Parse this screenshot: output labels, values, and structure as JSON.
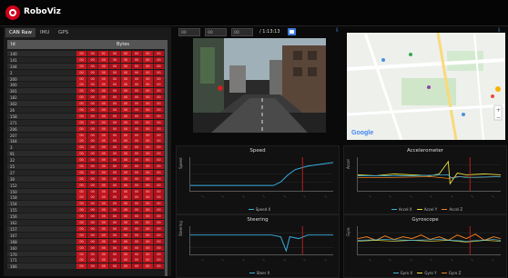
{
  "app": {
    "title": "RoboViz"
  },
  "left": {
    "tabs": [
      "CAN Raw",
      "IMU",
      "GPS"
    ],
    "columns": {
      "id": "Id",
      "bytes": "Bytes"
    },
    "rows": [
      {
        "id": "140",
        "bytes": [
          "00",
          "00",
          "01",
          "00",
          "00",
          "00",
          "00",
          "00"
        ]
      },
      {
        "id": "141",
        "bytes": [
          "00",
          "00",
          "00",
          "30",
          "30",
          "00",
          "00",
          "00"
        ]
      },
      {
        "id": "144",
        "bytes": [
          "00",
          "00",
          "00",
          "00",
          "00",
          "00",
          "00",
          "00"
        ]
      },
      {
        "id": "2",
        "bytes": [
          "00",
          "00",
          "00",
          "00",
          "00",
          "00",
          "00",
          "00"
        ]
      },
      {
        "id": "200",
        "bytes": [
          "00",
          "00",
          "00",
          "00",
          "00",
          "00",
          "00",
          "00"
        ]
      },
      {
        "id": "300",
        "bytes": [
          "00",
          "00",
          "00",
          "00",
          "00",
          "00",
          "00",
          "00"
        ]
      },
      {
        "id": "301",
        "bytes": [
          "00",
          "00",
          "00",
          "00",
          "00",
          "00",
          "00",
          "00"
        ]
      },
      {
        "id": "182",
        "bytes": [
          "00",
          "00",
          "00",
          "00",
          "00",
          "00",
          "00",
          "00"
        ]
      },
      {
        "id": "302",
        "bytes": [
          "00",
          "00",
          "00",
          "00",
          "00",
          "00",
          "00",
          "00"
        ]
      },
      {
        "id": "26",
        "bytes": [
          "00",
          "00",
          "00",
          "00",
          "00",
          "00",
          "00",
          "00"
        ]
      },
      {
        "id": "158",
        "bytes": [
          "00",
          "00",
          "00",
          "00",
          "00",
          "00",
          "00",
          "00"
        ]
      },
      {
        "id": "271",
        "bytes": [
          "00",
          "00",
          "00",
          "00",
          "00",
          "00",
          "00",
          "00"
        ]
      },
      {
        "id": "206",
        "bytes": [
          "00",
          "00",
          "00",
          "00",
          "00",
          "00",
          "00",
          "00"
        ]
      },
      {
        "id": "207",
        "bytes": [
          "00",
          "00",
          "00",
          "00",
          "00",
          "00",
          "00",
          "00"
        ]
      },
      {
        "id": "164",
        "bytes": [
          "00",
          "00",
          "00",
          "00",
          "00",
          "00",
          "00",
          "00"
        ]
      },
      {
        "id": "3",
        "bytes": [
          "00",
          "00",
          "00",
          "00",
          "00",
          "00",
          "00",
          "00"
        ]
      },
      {
        "id": "91",
        "bytes": [
          "00",
          "00",
          "00",
          "00",
          "00",
          "00",
          "00",
          "00"
        ]
      },
      {
        "id": "22",
        "bytes": [
          "00",
          "00",
          "00",
          "00",
          "00",
          "00",
          "00",
          "00"
        ]
      },
      {
        "id": "25",
        "bytes": [
          "00",
          "00",
          "00",
          "00",
          "00",
          "00",
          "00",
          "00"
        ]
      },
      {
        "id": "27",
        "bytes": [
          "00",
          "00",
          "00",
          "00",
          "00",
          "00",
          "00",
          "00"
        ]
      },
      {
        "id": "30",
        "bytes": [
          "00",
          "00",
          "00",
          "00",
          "00",
          "00",
          "00",
          "00"
        ]
      },
      {
        "id": "152",
        "bytes": [
          "00",
          "00",
          "00",
          "00",
          "00",
          "00",
          "00",
          "00"
        ]
      },
      {
        "id": "150",
        "bytes": [
          "00",
          "00",
          "00",
          "00",
          "00",
          "00",
          "00",
          "00"
        ]
      },
      {
        "id": "158",
        "bytes": [
          "00",
          "00",
          "00",
          "00",
          "00",
          "00",
          "00",
          "00"
        ]
      },
      {
        "id": "154",
        "bytes": [
          "00",
          "00",
          "00",
          "00",
          "00",
          "00",
          "00",
          "00"
        ]
      },
      {
        "id": "155",
        "bytes": [
          "00",
          "00",
          "00",
          "00",
          "00",
          "00",
          "00",
          "00"
        ]
      },
      {
        "id": "156",
        "bytes": [
          "00",
          "00",
          "00",
          "00",
          "00",
          "00",
          "00",
          "00"
        ]
      },
      {
        "id": "162",
        "bytes": [
          "00",
          "00",
          "00",
          "00",
          "00",
          "00",
          "00",
          "00"
        ]
      },
      {
        "id": "157",
        "bytes": [
          "00",
          "00",
          "00",
          "00",
          "00",
          "00",
          "00",
          "00"
        ]
      },
      {
        "id": "167",
        "bytes": [
          "00",
          "00",
          "00",
          "00",
          "00",
          "00",
          "00",
          "00"
        ]
      },
      {
        "id": "168",
        "bytes": [
          "00",
          "00",
          "00",
          "00",
          "00",
          "00",
          "00",
          "00"
        ]
      },
      {
        "id": "160",
        "bytes": [
          "00",
          "00",
          "00",
          "00",
          "00",
          "00",
          "00",
          "00"
        ]
      },
      {
        "id": "170",
        "bytes": [
          "00",
          "00",
          "00",
          "00",
          "00",
          "00",
          "00",
          "00"
        ]
      },
      {
        "id": "171",
        "bytes": [
          "00",
          "00",
          "00",
          "00",
          "00",
          "00",
          "00",
          "00"
        ]
      },
      {
        "id": "166",
        "bytes": [
          "00",
          "00",
          "00",
          "00",
          "00",
          "00",
          "00",
          "00"
        ]
      }
    ]
  },
  "player": {
    "selects": [
      "00",
      "00",
      "00"
    ],
    "timecode": "/ 1:13:13"
  },
  "charts": [
    {
      "id": "speed",
      "title": "Speed",
      "ylabel": "Speed",
      "legend": [
        {
          "name": "Speed X",
          "color": "#3ab0e0"
        }
      ]
    },
    {
      "id": "accel",
      "title": "Accelerometer",
      "ylabel": "Accel",
      "legend": [
        {
          "name": "Accel X",
          "color": "#3ab0e0"
        },
        {
          "name": "Accel Y",
          "color": "#f0e040"
        },
        {
          "name": "Accel Z",
          "color": "#f08020"
        }
      ]
    },
    {
      "id": "steer",
      "title": "Steering",
      "ylabel": "Steering",
      "legend": [
        {
          "name": "Steer X",
          "color": "#3ab0e0"
        }
      ]
    },
    {
      "id": "gyro",
      "title": "Gyroscope",
      "ylabel": "Gyro",
      "legend": [
        {
          "name": "Gyro X",
          "color": "#3ab0e0"
        },
        {
          "name": "Gyro Y",
          "color": "#f0e040"
        },
        {
          "name": "Gyro Z",
          "color": "#f08020"
        }
      ]
    }
  ]
}
